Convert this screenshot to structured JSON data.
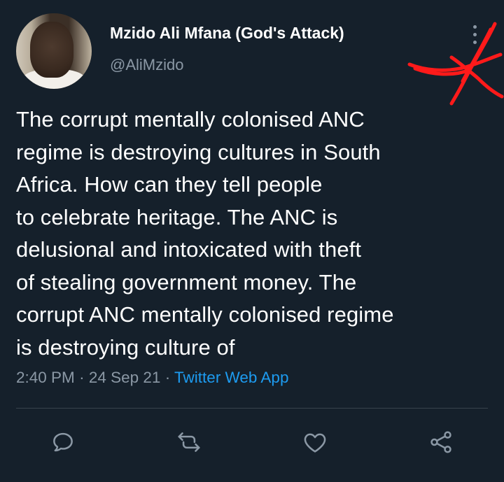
{
  "author": {
    "display_name": "Mzido Ali Mfana (God's Attack)",
    "handle": "@AliMzido"
  },
  "tweet": {
    "lines": [
      "The corrupt mentally colonised ANC",
      "regime is destroying cultures in South",
      "Africa. How can they tell people",
      "to celebrate heritage. The ANC is",
      "delusional and intoxicated with theft",
      "of stealing government money. The",
      "corrupt ANC mentally colonised regime",
      "is destroying culture of"
    ],
    "time": "2:40 PM",
    "separator": "·",
    "date": "24 Sep 21",
    "source": "Twitter Web App"
  },
  "actions": {
    "reply_icon": "reply-icon",
    "retweet_icon": "retweet-icon",
    "like_icon": "like-icon",
    "share_icon": "share-icon"
  },
  "colors": {
    "background": "#15202b",
    "text": "#ffffff",
    "secondary": "#8b98a5",
    "link": "#1d9bf0",
    "annotation": "#ff1a1a"
  }
}
